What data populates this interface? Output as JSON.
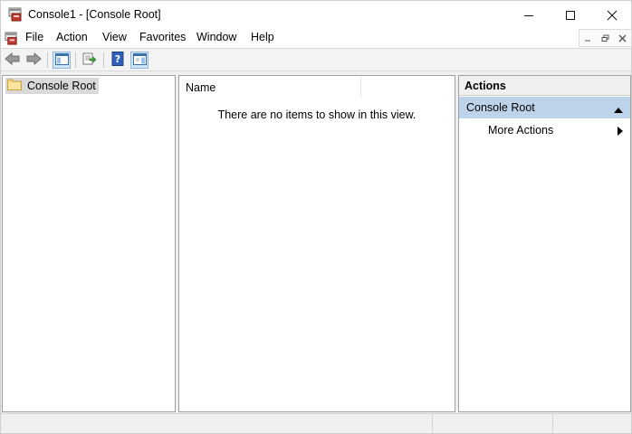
{
  "window": {
    "title": "Console1 - [Console Root]",
    "controls": {
      "minimize": "minimize",
      "maximize": "maximize",
      "close": "close"
    }
  },
  "menu": {
    "items": [
      {
        "label": "File"
      },
      {
        "label": "Action"
      },
      {
        "label": "View"
      },
      {
        "label": "Favorites"
      },
      {
        "label": "Window"
      },
      {
        "label": "Help"
      }
    ]
  },
  "toolbar": {
    "buttons": [
      "back-icon",
      "forward-icon",
      "show-hide-tree-icon",
      "export-list-icon",
      "help-icon",
      "show-hide-action-pane-icon"
    ]
  },
  "tree": {
    "root_label": "Console Root"
  },
  "results": {
    "column_name": "Name",
    "empty_message": "There are no items to show in this view."
  },
  "actions": {
    "header": "Actions",
    "section_label": "Console Root",
    "items": [
      {
        "label": "More Actions"
      }
    ]
  },
  "colors": {
    "section_highlight": "#bdd3ea",
    "tree_selection": "#d9d9d9"
  }
}
